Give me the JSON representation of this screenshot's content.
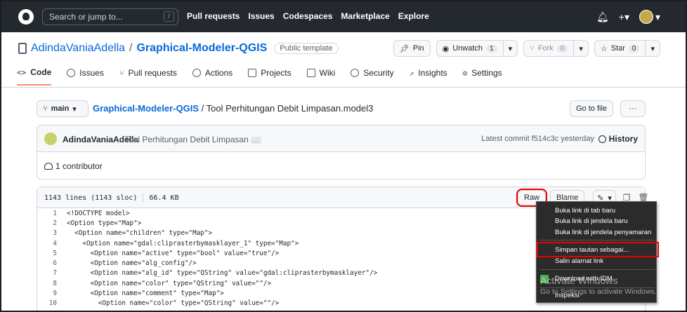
{
  "header": {
    "search_placeholder": "Search or jump to...",
    "search_shortcut": "/",
    "nav": [
      "Pull requests",
      "Issues",
      "Codespaces",
      "Marketplace",
      "Explore"
    ],
    "plus_label": "+"
  },
  "repo": {
    "owner": "AdindaVaniaAdella",
    "separator": "/",
    "name": "Graphical-Modeler-QGIS",
    "badge": "Public template",
    "pin_label": "Pin",
    "unwatch_label": "Unwatch",
    "unwatch_count": "1",
    "fork_label": "Fork",
    "fork_count": "0",
    "star_label": "Star",
    "star_count": "0"
  },
  "tabs": [
    {
      "label": "Code",
      "icon": "code-icon"
    },
    {
      "label": "Issues",
      "icon": "issue-icon"
    },
    {
      "label": "Pull requests",
      "icon": "pull-request-icon"
    },
    {
      "label": "Actions",
      "icon": "play-icon"
    },
    {
      "label": "Projects",
      "icon": "table-icon"
    },
    {
      "label": "Wiki",
      "icon": "book-icon"
    },
    {
      "label": "Security",
      "icon": "shield-icon"
    },
    {
      "label": "Insights",
      "icon": "graph-icon"
    },
    {
      "label": "Settings",
      "icon": "gear-icon"
    }
  ],
  "breadcrumb": {
    "branch": "main",
    "repo_link": "Graphical-Modeler-QGIS",
    "separator": "/",
    "file": "Tool Perhitungan Debit Limpasan.model3",
    "goto_label": "Go to file",
    "more_label": "···"
  },
  "commit": {
    "author": "AdindaVaniaAdella",
    "message": "Tool Perhitungan Debit Limpasan",
    "ellipsis": "…",
    "latest": "Latest commit f514c3c yesterday",
    "history_label": "History",
    "contributors": "1 contributor"
  },
  "file": {
    "lines_info": "1143 lines (1143 sloc)",
    "size": "66.4 KB",
    "raw_label": "Raw",
    "blame_label": "Blame",
    "code_lines": [
      {
        "n": "1",
        "text": "<!DOCTYPE model>"
      },
      {
        "n": "2",
        "text": "<Option type=\"Map\">"
      },
      {
        "n": "3",
        "text": "  <Option name=\"children\" type=\"Map\">"
      },
      {
        "n": "4",
        "text": "    <Option name=\"gdal:cliprasterbymasklayer_1\" type=\"Map\">"
      },
      {
        "n": "5",
        "text": "      <Option name=\"active\" type=\"bool\" value=\"true\"/>"
      },
      {
        "n": "6",
        "text": "      <Option name=\"alg_config\"/>"
      },
      {
        "n": "7",
        "text": "      <Option name=\"alg_id\" type=\"QString\" value=\"gdal:cliprasterbymasklayer\"/>"
      },
      {
        "n": "8",
        "text": "      <Option name=\"color\" type=\"QString\" value=\"\"/>"
      },
      {
        "n": "9",
        "text": "      <Option name=\"comment\" type=\"Map\">"
      },
      {
        "n": "10",
        "text": "        <Option name=\"color\" type=\"QString\" value=\"\"/>"
      }
    ]
  },
  "context_menu": {
    "items": [
      "Buka link di tab baru",
      "Buka link di jendela baru",
      "Buka link di jendela penyamaran",
      "Simpan tautan sebagai...",
      "Salin alamat link",
      "Download with IDM",
      "Inspeksi"
    ],
    "highlight_color": "#e00000"
  },
  "watermark": {
    "line1": "Activate Windows",
    "line2": "Go to Settings to activate Windows."
  }
}
